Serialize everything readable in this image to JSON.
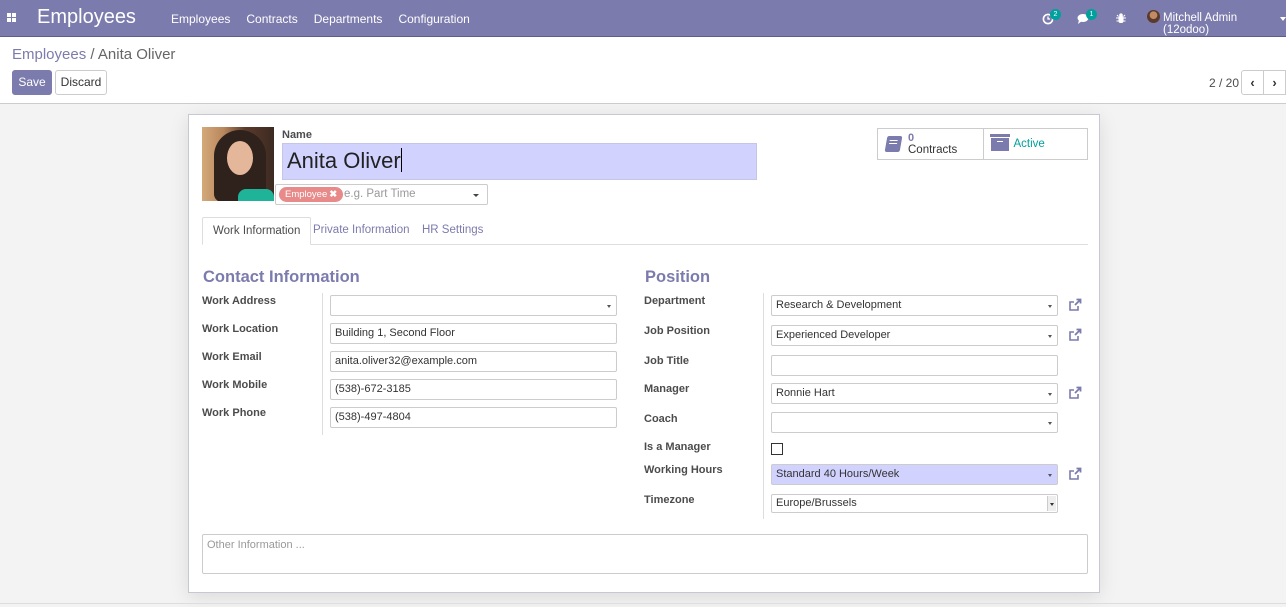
{
  "navbar": {
    "app_title": "Employees",
    "menu": [
      "Employees",
      "Contracts",
      "Departments",
      "Configuration"
    ],
    "activity_badge": "2",
    "messages_badge": "1",
    "user_name": "Mitchell Admin (12odoo)",
    "accent_color": "#7c7bad",
    "badge_color": "#00a09d"
  },
  "breadcrumb": {
    "parent": "Employees",
    "separator": " / ",
    "current": "Anita Oliver"
  },
  "toolbar": {
    "save_label": "Save",
    "discard_label": "Discard"
  },
  "pager": {
    "value": "2 / 20",
    "prev": "‹",
    "next": "›"
  },
  "employee": {
    "name_label": "Name",
    "name": "Anita Oliver",
    "tags": [
      "Employee"
    ],
    "tags_placeholder": "e.g. Part Time"
  },
  "smart_buttons": {
    "contracts_count": "0",
    "contracts_label": "Contracts",
    "active_label": "Active"
  },
  "tabs": [
    "Work Information",
    "Private Information",
    "HR Settings"
  ],
  "contact": {
    "title": "Contact Information",
    "fields": [
      {
        "label": "Work Address",
        "value": ""
      },
      {
        "label": "Work Location",
        "value": "Building 1, Second Floor"
      },
      {
        "label": "Work Email",
        "value": "anita.oliver32@example.com"
      },
      {
        "label": "Work Mobile",
        "value": "(538)-672-3185"
      },
      {
        "label": "Work Phone",
        "value": "(538)-497-4804"
      }
    ]
  },
  "position": {
    "title": "Position",
    "fields": [
      {
        "label": "Department",
        "value": "Research & Development"
      },
      {
        "label": "Job Position",
        "value": "Experienced Developer"
      },
      {
        "label": "Job Title",
        "value": ""
      },
      {
        "label": "Manager",
        "value": "Ronnie Hart"
      },
      {
        "label": "Coach",
        "value": ""
      },
      {
        "label": "Is a Manager",
        "value": false
      },
      {
        "label": "Working Hours",
        "value": "Standard 40 Hours/Week"
      },
      {
        "label": "Timezone",
        "value": "Europe/Brussels"
      }
    ]
  },
  "notes": {
    "placeholder": "Other Information ..."
  }
}
